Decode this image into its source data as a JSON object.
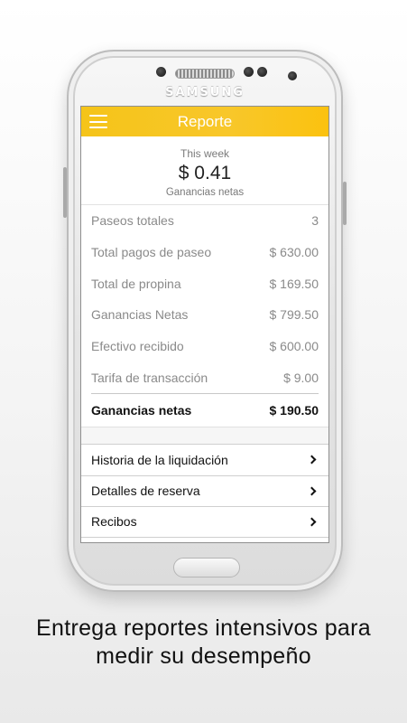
{
  "device": {
    "brand": "SAMSUNG"
  },
  "appbar": {
    "title": "Reporte",
    "menu_icon": "hamburger-menu-icon"
  },
  "summary": {
    "period": "This week",
    "amount": "$ 0.41",
    "label": "Ganancias netas"
  },
  "stats": [
    {
      "label": "Paseos totales",
      "value": "3"
    },
    {
      "label": "Total pagos de paseo",
      "value": "$ 630.00"
    },
    {
      "label": "Total de propina",
      "value": "$ 169.50"
    },
    {
      "label": "Ganancias Netas",
      "value": "$ 799.50"
    },
    {
      "label": "Efectivo recibido",
      "value": "$ 600.00"
    },
    {
      "label": "Tarifa de transacción",
      "value": "$ 9.00"
    }
  ],
  "total": {
    "label": "Ganancias netas",
    "value": "$ 190.50"
  },
  "nav": [
    {
      "label": "Historia de la liquidación",
      "icon": "chevron-right-icon"
    },
    {
      "label": "Detalles de reserva",
      "icon": "chevron-right-icon"
    },
    {
      "label": "Recibos",
      "icon": "chevron-right-icon"
    }
  ],
  "caption": {
    "line1": "Entrega reportes intensivos para",
    "line2": "medir su desempeño"
  },
  "colors": {
    "accent": "#f8c72a",
    "text": "#111111",
    "muted": "#8a8a8a"
  }
}
